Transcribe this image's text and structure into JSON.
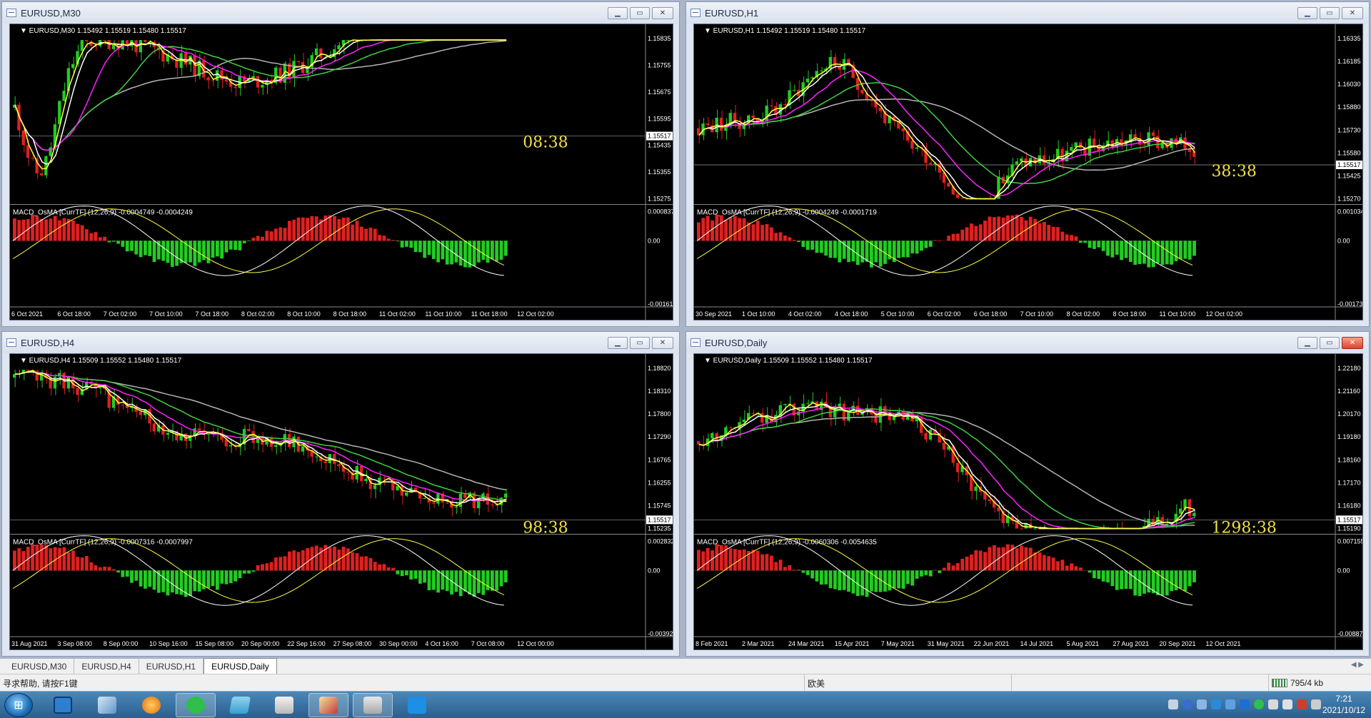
{
  "windows": [
    {
      "id": "m30",
      "title": "EURUSD,M30",
      "info": "EURUSD,M30  1.15492 1.15519 1.15480 1.15517",
      "price_labels": [
        "1.15835",
        "1.15755",
        "1.15675",
        "1.15595",
        "1.15435",
        "1.15355",
        "1.15275"
      ],
      "current_price": "1.15517",
      "timer": "08:38",
      "macd_info": "MACD_OsMA [CurrTF] (12,26,9) -0.0004749 -0.0004249",
      "macd_labels": [
        "0.0008372",
        "0.00",
        "-0.001612"
      ],
      "time_labels": [
        "6 Oct 2021",
        "6 Oct 18:00",
        "7 Oct 02:00",
        "7 Oct 10:00",
        "7 Oct 18:00",
        "8 Oct 02:00",
        "8 Oct 10:00",
        "8 Oct 18:00",
        "11 Oct 02:00",
        "11 Oct 10:00",
        "11 Oct 18:00",
        "12 Oct 02:00"
      ]
    },
    {
      "id": "h1",
      "title": "EURUSD,H1",
      "info": "EURUSD,H1  1.15492 1.15519 1.15480 1.15517",
      "price_labels": [
        "1.16335",
        "1.16185",
        "1.16030",
        "1.15880",
        "1.15730",
        "1.15580",
        "1.15425",
        "1.15270"
      ],
      "current_price": "1.15517",
      "timer": "38:38",
      "macd_info": "MACD_OsMA [CurrTF] (12,26,9) -0.0004249 -0.0001719",
      "macd_labels": [
        "0.0010341",
        "0.00",
        "-0.001731"
      ],
      "time_labels": [
        "30 Sep 2021",
        "1 Oct 10:00",
        "4 Oct 02:00",
        "4 Oct 18:00",
        "5 Oct 10:00",
        "6 Oct 02:00",
        "6 Oct 18:00",
        "7 Oct 10:00",
        "8 Oct 02:00",
        "8 Oct 18:00",
        "11 Oct 10:00",
        "12 Oct 02:00"
      ]
    },
    {
      "id": "h4",
      "title": "EURUSD,H4",
      "info": "EURUSD,H4  1.15509 1.15552 1.15480 1.15517",
      "price_labels": [
        "1.18820",
        "1.18310",
        "1.17800",
        "1.17290",
        "1.16765",
        "1.16255",
        "1.15745",
        "1.15235"
      ],
      "current_price": "1.15517",
      "timer": "98:38",
      "macd_info": "MACD_OsMA [CurrTF] (12,26,9) -0.0007316 -0.0007997",
      "macd_labels": [
        "0.0028328",
        "0.00",
        "-0.003929"
      ],
      "time_labels": [
        "31 Aug 2021",
        "3 Sep 08:00",
        "8 Sep 00:00",
        "10 Sep 16:00",
        "15 Sep 08:00",
        "20 Sep 00:00",
        "22 Sep 16:00",
        "27 Sep 08:00",
        "30 Sep 00:00",
        "4 Oct 16:00",
        "7 Oct 08:00",
        "12 Oct 00:00"
      ]
    },
    {
      "id": "d1",
      "title": "EURUSD,Daily",
      "info": "EURUSD,Daily  1.15509 1.15552 1.15480 1.15517",
      "price_labels": [
        "1.22180",
        "1.21160",
        "1.20170",
        "1.19180",
        "1.18160",
        "1.17170",
        "1.16180",
        "1.15190"
      ],
      "current_price": "1.15517",
      "timer": "1298:38",
      "macd_info": "MACD_OsMA [CurrTF] (12,26,9) -0.0060306 -0.0054635",
      "macd_labels": [
        "0.0071554",
        "0.00",
        "-0.008872"
      ],
      "time_labels": [
        "8 Feb 2021",
        "2 Mar 2021",
        "24 Mar 2021",
        "15 Apr 2021",
        "7 May 2021",
        "31 May 2021",
        "22 Jun 2021",
        "14 Jul 2021",
        "5 Aug 2021",
        "27 Aug 2021",
        "20 Sep 2021",
        "12 Oct 2021"
      ]
    }
  ],
  "tabs": [
    "EURUSD,M30",
    "EURUSD,H4",
    "EURUSD,H1",
    "EURUSD,Daily"
  ],
  "active_tab": "EURUSD,Daily",
  "status": {
    "help": "寻求帮助, 请按F1键",
    "profile": "欧美",
    "traffic": "795/4 kb"
  },
  "clock": {
    "time": "7:21",
    "date": "2021/10/12"
  },
  "colors": {
    "chart_bg": "#000000",
    "bull": "#22cc22",
    "bear": "#e02020",
    "ma_fast": "#ffff40",
    "ma_white": "#ffffff",
    "ma_magenta": "#ff20ff",
    "ma_green": "#40d040",
    "ma_gray": "#b4b4b4",
    "timer": "#f0e040"
  }
}
